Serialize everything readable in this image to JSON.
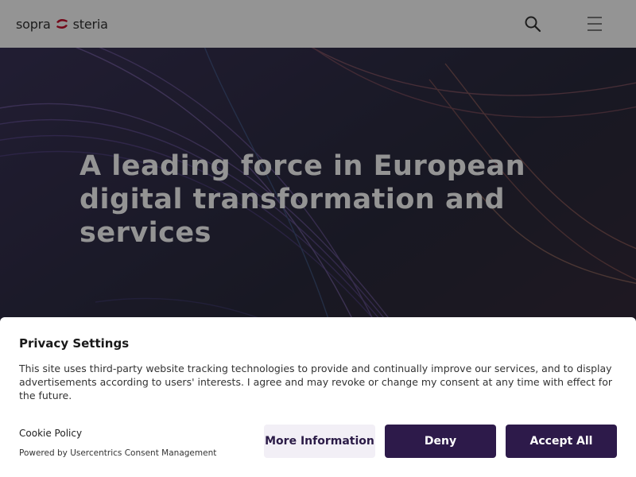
{
  "header": {
    "logo_left": "sopra",
    "logo_right": "steria",
    "search_icon": "search-icon",
    "menu_icon": "hamburger-menu-icon"
  },
  "hero": {
    "title": "A leading force in European digital transformation and services"
  },
  "consent": {
    "title": "Privacy Settings",
    "text": "This site uses third-party website tracking technologies to provide and continually improve our services, and to display advertisements according to users' interests. I agree and may revoke or change my consent at any time with effect for the future.",
    "cookie_policy_label": "Cookie Policy",
    "powered_by": "Powered by Usercentrics Consent Management",
    "more_info_label": "More Information",
    "deny_label": "Deny",
    "accept_all_label": "Accept All"
  },
  "colors": {
    "accent_dark": "#2d1a4a",
    "accent_light": "#f2eff6",
    "logo_red": "#c8102e"
  }
}
